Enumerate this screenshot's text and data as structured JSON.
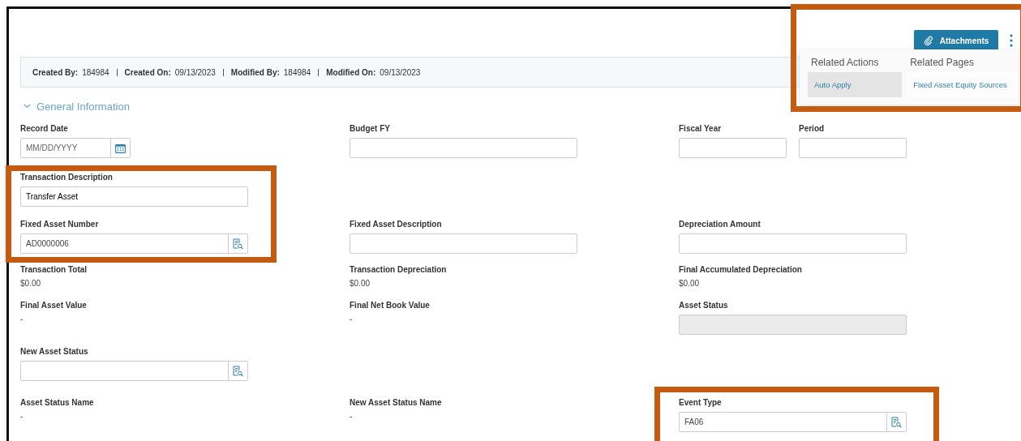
{
  "header": {
    "attachments_button": "Attachments"
  },
  "related_menu": {
    "columns": [
      {
        "title": "Related Actions",
        "items": [
          {
            "label": "Auto Apply",
            "selected": true
          }
        ]
      },
      {
        "title": "Related Pages",
        "items": [
          {
            "label": "Fixed Asset Equity Sources",
            "selected": false
          }
        ]
      }
    ]
  },
  "meta": [
    {
      "label": "Created By:",
      "value": "184984"
    },
    {
      "label": "Created On:",
      "value": "09/13/2023"
    },
    {
      "label": "Modified By:",
      "value": "184984"
    },
    {
      "label": "Modified On:",
      "value": "09/13/2023"
    }
  ],
  "section": {
    "title": "General Information",
    "expanded": true
  },
  "rows": [
    [
      [
        {
          "kind": "date",
          "label": "Record Date",
          "placeholder": "MM/DD/YYYY"
        }
      ],
      [
        {
          "kind": "text",
          "label": "Budget FY"
        }
      ],
      [
        {
          "kind": "short",
          "label": "Fiscal Year"
        },
        {
          "kind": "short",
          "label": "Period"
        }
      ]
    ],
    [
      [
        {
          "kind": "text",
          "label": "Transaction Description",
          "value": "Transfer Asset"
        }
      ],
      null,
      null
    ],
    [
      [
        {
          "kind": "lookup",
          "label": "Fixed Asset Number",
          "value": "AD0000006"
        }
      ],
      [
        {
          "kind": "text",
          "label": "Fixed Asset Description"
        }
      ],
      [
        {
          "kind": "text",
          "label": "Depreciation Amount"
        }
      ]
    ],
    [
      [
        {
          "kind": "readonly",
          "label": "Transaction Total",
          "value": "$0.00"
        }
      ],
      [
        {
          "kind": "readonly",
          "label": "Transaction Depreciation",
          "value": "$0.00"
        }
      ],
      [
        {
          "kind": "readonly",
          "label": "Final Accumulated Depreciation",
          "value": "$0.00"
        }
      ]
    ],
    [
      [
        {
          "kind": "readonly",
          "label": "Final Asset Value",
          "value": "-"
        }
      ],
      [
        {
          "kind": "readonly",
          "label": "Final Net Book Value",
          "value": "-"
        }
      ],
      [
        {
          "kind": "disabled",
          "label": "Asset Status"
        }
      ]
    ],
    [
      [
        {
          "kind": "lookup",
          "label": "New Asset Status"
        }
      ],
      null,
      null
    ],
    [
      [
        {
          "kind": "readonly",
          "label": "Asset Status Name",
          "value": "-"
        }
      ],
      [
        {
          "kind": "readonly",
          "label": "New Asset Status Name",
          "value": "-"
        }
      ],
      [
        {
          "kind": "lookup",
          "label": "Event Type",
          "value": "FA06"
        }
      ]
    ]
  ]
}
